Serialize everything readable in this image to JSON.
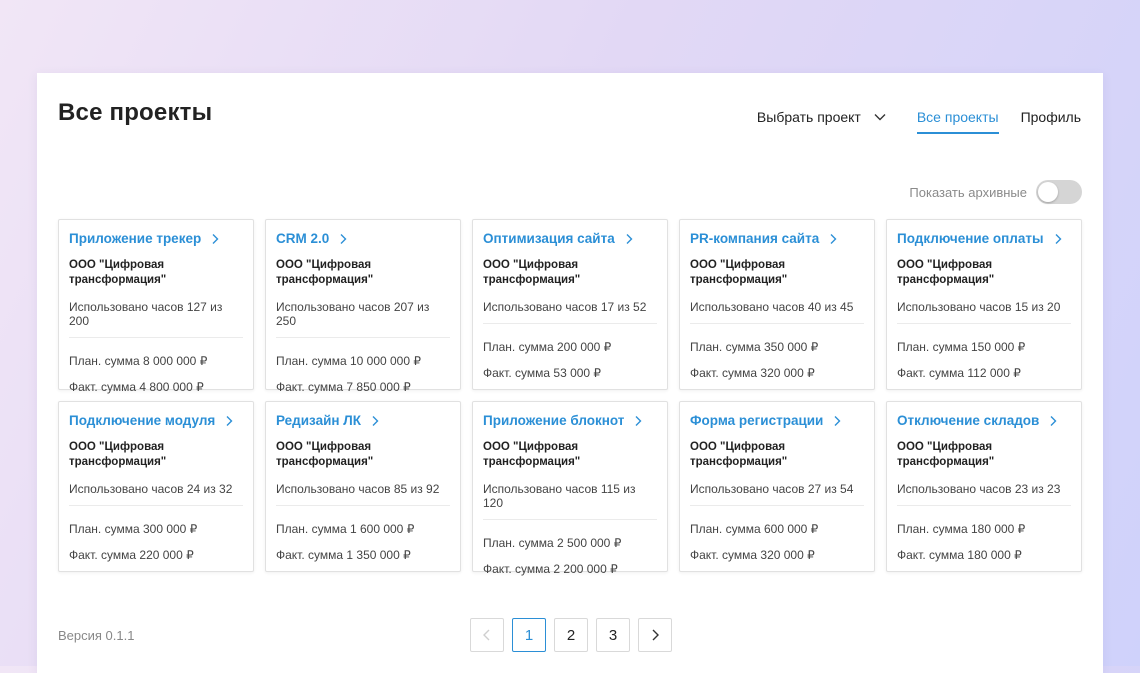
{
  "header": {
    "title": "Все проекты",
    "select_project": "Выбрать проект",
    "all_projects": "Все проекты",
    "profile": "Профиль"
  },
  "archive": {
    "label": "Показать архивные",
    "enabled": false
  },
  "colors": {
    "accent": "#2b8fd6",
    "toggle_off": "#d5d5d5"
  },
  "projects": [
    {
      "name": "Приложение трекер",
      "company": "ООО \"Цифровая трансформация\"",
      "hours": "Использовано часов 127 из 200",
      "plan": "План. сумма 8 000 000 ₽",
      "fact": "Факт. сумма 4 800 000 ₽"
    },
    {
      "name": "CRM 2.0",
      "company": "ООО \"Цифровая трансформация\"",
      "hours": "Использовано часов 207 из 250",
      "plan": "План. сумма 10 000 000 ₽",
      "fact": "Факт. сумма 7 850 000 ₽"
    },
    {
      "name": "Оптимизация сайта",
      "company": "ООО \"Цифровая трансформация\"",
      "hours": "Использовано часов 17 из 52",
      "plan": "План. сумма 200 000 ₽",
      "fact": "Факт. сумма 53 000 ₽"
    },
    {
      "name": "PR-компания сайта",
      "company": "ООО \"Цифровая трансформация\"",
      "hours": "Использовано часов 40 из 45",
      "plan": "План. сумма 350 000 ₽",
      "fact": "Факт. сумма 320 000 ₽"
    },
    {
      "name": "Подключение оплаты",
      "company": "ООО \"Цифровая трансформация\"",
      "hours": "Использовано часов 15 из 20",
      "plan": "План. сумма 150 000 ₽",
      "fact": "Факт. сумма 112 000 ₽"
    },
    {
      "name": "Подключение модуля",
      "company": "ООО \"Цифровая трансформация\"",
      "hours": "Использовано часов 24 из 32",
      "plan": "План. сумма 300 000 ₽",
      "fact": "Факт. сумма 220 000 ₽"
    },
    {
      "name": "Редизайн ЛК",
      "company": "ООО \"Цифровая трансформация\"",
      "hours": "Использовано часов 85 из 92",
      "plan": "План. сумма 1 600 000 ₽",
      "fact": "Факт. сумма 1 350 000 ₽"
    },
    {
      "name": "Приложение блокнот",
      "company": "ООО \"Цифровая трансформация\"",
      "hours": "Использовано часов 115 из 120",
      "plan": "План. сумма 2 500 000 ₽",
      "fact": "Факт. сумма 2 200 000 ₽"
    },
    {
      "name": "Форма регистрации",
      "company": "ООО \"Цифровая трансформация\"",
      "hours": "Использовано часов 27 из 54",
      "plan": "План. сумма 600 000 ₽",
      "fact": "Факт. сумма 320 000 ₽"
    },
    {
      "name": "Отключение складов",
      "company": "ООО \"Цифровая трансформация\"",
      "hours": "Использовано часов 23 из 23",
      "plan": "План. сумма 180 000 ₽",
      "fact": "Факт. сумма 180 000 ₽"
    }
  ],
  "footer": {
    "version": "Версия 0.1.1"
  },
  "pagination": {
    "pages": [
      "1",
      "2",
      "3"
    ],
    "current": "1"
  }
}
